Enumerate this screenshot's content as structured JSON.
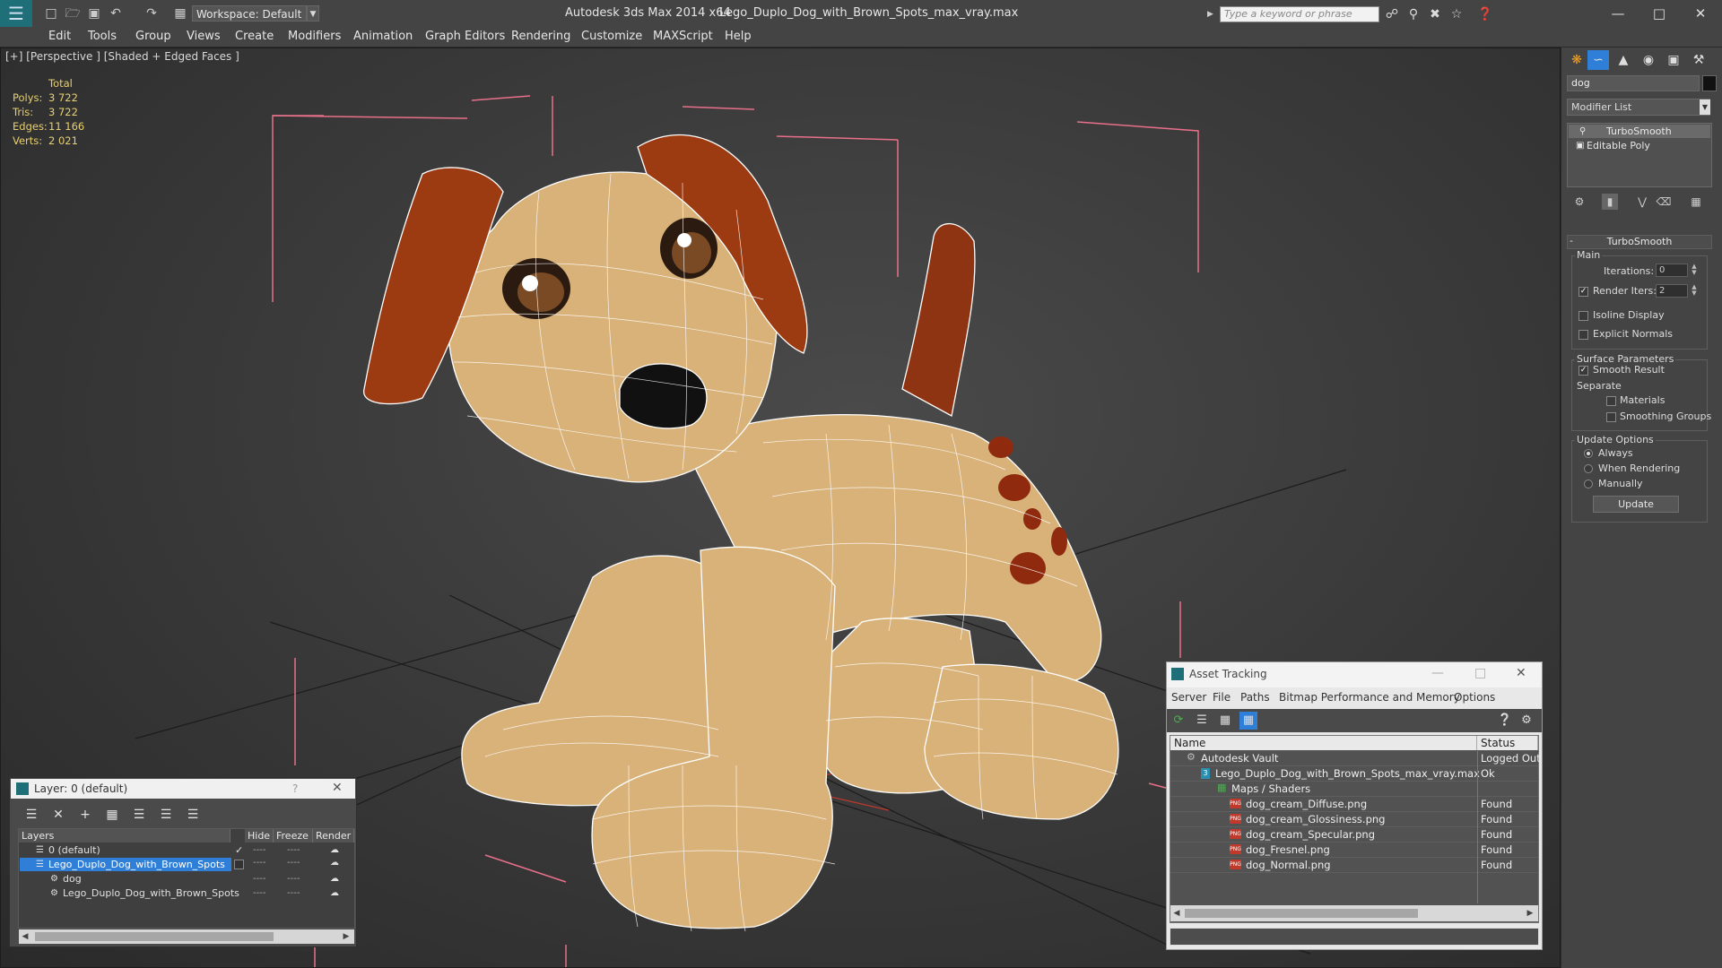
{
  "titlebar": {
    "app_title": "Autodesk 3ds Max 2014 x64",
    "doc_name": "Lego_Duplo_Dog_with_Brown_Spots_max_vray.max",
    "workspace": "Workspace: Default",
    "search_placeholder": "Type a keyword or phrase"
  },
  "menu": [
    "Edit",
    "Tools",
    "Group",
    "Views",
    "Create",
    "Modifiers",
    "Animation",
    "Graph Editors",
    "Rendering",
    "Customize",
    "MAXScript",
    "Help"
  ],
  "viewport": {
    "label": "[+] [Perspective ] [Shaded + Edged Faces ]",
    "stats": {
      "header": "Total",
      "rows": [
        {
          "key": "Polys:",
          "value": "3 722"
        },
        {
          "key": "Tris:",
          "value": "3 722"
        },
        {
          "key": "Edges:",
          "value": "11 166"
        },
        {
          "key": "Verts:",
          "value": "2 021"
        }
      ]
    }
  },
  "command_panel": {
    "object_name": "dog",
    "modifier_list": "Modifier List",
    "stack": [
      "TurboSmooth",
      "Editable Poly"
    ],
    "rollout_title": "TurboSmooth",
    "main_group": "Main",
    "iterations_label": "Iterations:",
    "iterations_value": "0",
    "render_iters_label": "Render Iters:",
    "render_iters_value": "2",
    "isoline_label": "Isoline Display",
    "explicit_normals_label": "Explicit Normals",
    "surface_group": "Surface Parameters",
    "smooth_result_label": "Smooth Result",
    "separate_label": "Separate",
    "materials_label": "Materials",
    "smoothing_groups_label": "Smoothing Groups",
    "update_group": "Update Options",
    "always_label": "Always",
    "when_rendering_label": "When Rendering",
    "manually_label": "Manually",
    "update_button": "Update"
  },
  "layer_dialog": {
    "title": "Layer: 0 (default)",
    "help": "?",
    "headers": {
      "layers": "Layers",
      "hide": "Hide",
      "freeze": "Freeze",
      "render": "Render"
    },
    "rows": [
      {
        "name": "0 (default)"
      },
      {
        "name": "Lego_Duplo_Dog_with_Brown_Spots"
      },
      {
        "name": "dog"
      },
      {
        "name": "Lego_Duplo_Dog_with_Brown_Spots"
      }
    ],
    "dash": "----"
  },
  "asset_dialog": {
    "title": "Asset Tracking",
    "menu": [
      "Server",
      "File",
      "Paths",
      "Bitmap Performance and Memory",
      "Options"
    ],
    "headers": {
      "name": "Name",
      "status": "Status"
    },
    "rows": [
      {
        "name": "Autodesk Vault",
        "status": "Logged Out"
      },
      {
        "name": "Lego_Duplo_Dog_with_Brown_Spots_max_vray.max",
        "status": "Ok"
      },
      {
        "name": "Maps / Shaders",
        "status": ""
      },
      {
        "name": "dog_cream_Diffuse.png",
        "status": "Found"
      },
      {
        "name": "dog_cream_Glossiness.png",
        "status": "Found"
      },
      {
        "name": "dog_cream_Specular.png",
        "status": "Found"
      },
      {
        "name": "dog_Fresnel.png",
        "status": "Found"
      },
      {
        "name": "dog_Normal.png",
        "status": "Found"
      }
    ],
    "file_badge": "PNG"
  },
  "colors": {
    "dog_body": "#d9b27a",
    "dog_ear": "#9c3a12",
    "wire": "#ffffff",
    "selection": "#2f7fd9",
    "bbox": "#e8708a"
  }
}
